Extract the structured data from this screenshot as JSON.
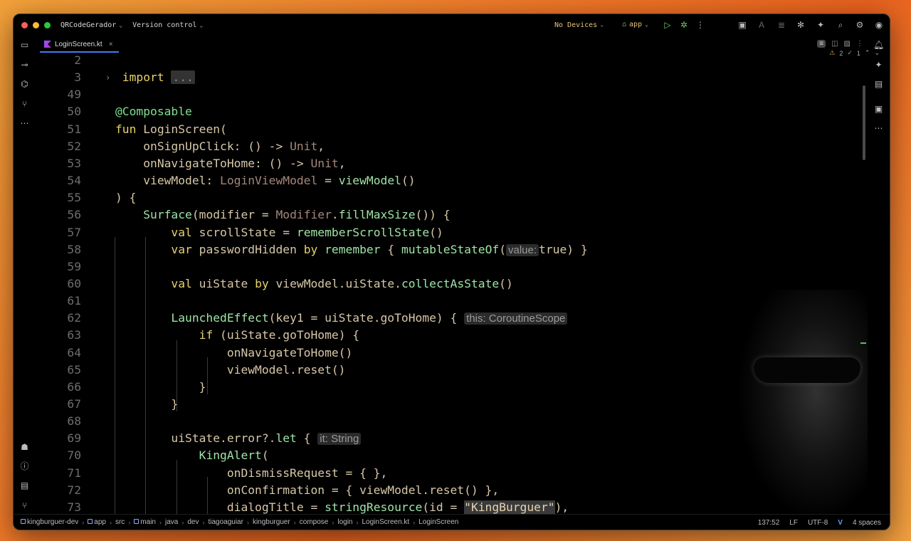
{
  "titlebar": {
    "project": "QRCodeGerador",
    "vcs": "Version control",
    "devices": "No Devices",
    "run_config": "app"
  },
  "tab": {
    "filename": "LoginScreen.kt",
    "close": "×"
  },
  "inspections": {
    "warnings": "2",
    "ok": "1"
  },
  "code_lines": [
    {
      "n": "2",
      "text": ""
    },
    {
      "n": "3",
      "text": "import ..."
    },
    {
      "n": "49",
      "text": ""
    },
    {
      "n": "50",
      "text": "@Composable"
    },
    {
      "n": "51",
      "text": "fun LoginScreen("
    },
    {
      "n": "52",
      "text": "    onSignUpClick: () -> Unit,"
    },
    {
      "n": "53",
      "text": "    onNavigateToHome: () -> Unit,"
    },
    {
      "n": "54",
      "text": "    viewModel: LoginViewModel = viewModel()"
    },
    {
      "n": "55",
      "text": ") {"
    },
    {
      "n": "56",
      "text": "    Surface(modifier = Modifier.fillMaxSize()) {"
    },
    {
      "n": "57",
      "text": "        val scrollState = rememberScrollState()"
    },
    {
      "n": "58",
      "text": "        var passwordHidden by remember { mutableStateOf(value: true) }"
    },
    {
      "n": "59",
      "text": ""
    },
    {
      "n": "60",
      "text": "        val uiState by viewModel.uiState.collectAsState()"
    },
    {
      "n": "61",
      "text": ""
    },
    {
      "n": "62",
      "text": "        LaunchedEffect(key1 = uiState.goToHome) { this: CoroutineScope"
    },
    {
      "n": "63",
      "text": "            if (uiState.goToHome) {"
    },
    {
      "n": "64",
      "text": "                onNavigateToHome()"
    },
    {
      "n": "65",
      "text": "                viewModel.reset()"
    },
    {
      "n": "66",
      "text": "            }"
    },
    {
      "n": "67",
      "text": "        }"
    },
    {
      "n": "68",
      "text": ""
    },
    {
      "n": "69",
      "text": "        uiState.error?.let { it: String"
    },
    {
      "n": "70",
      "text": "            KingAlert("
    },
    {
      "n": "71",
      "text": "                onDismissRequest = { },"
    },
    {
      "n": "72",
      "text": "                onConfirmation = { viewModel.reset() },"
    },
    {
      "n": "73",
      "text": "                dialogTitle = stringResource(id = \"KingBurguer\"),"
    }
  ],
  "breadcrumbs": [
    "kingburguer-dev",
    "app",
    "src",
    "main",
    "java",
    "dev",
    "tiagoaguiar",
    "kingburguer",
    "compose",
    "login",
    "LoginScreen.kt",
    "LoginScreen"
  ],
  "status": {
    "position": "137:52",
    "line_sep": "LF",
    "encoding": "UTF-8",
    "indent": "4 spaces"
  }
}
